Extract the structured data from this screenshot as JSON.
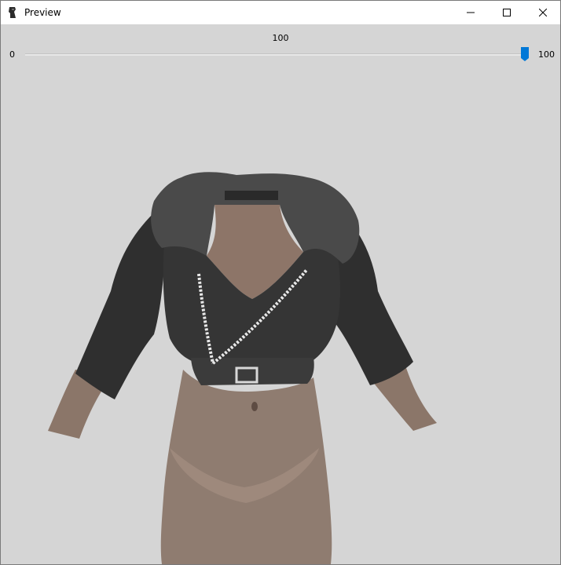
{
  "window": {
    "title": "Preview",
    "app_icon": "app-icon",
    "controls": [
      "minimize-icon",
      "maximize-icon",
      "close-icon"
    ]
  },
  "slider": {
    "current_value": "100",
    "min_label": "0",
    "max_label": "100",
    "value_fraction": 1.0,
    "accent_color": "#0078d7"
  },
  "preview": {
    "background_color": "#d5d5d5",
    "content": "3d-model-render"
  }
}
